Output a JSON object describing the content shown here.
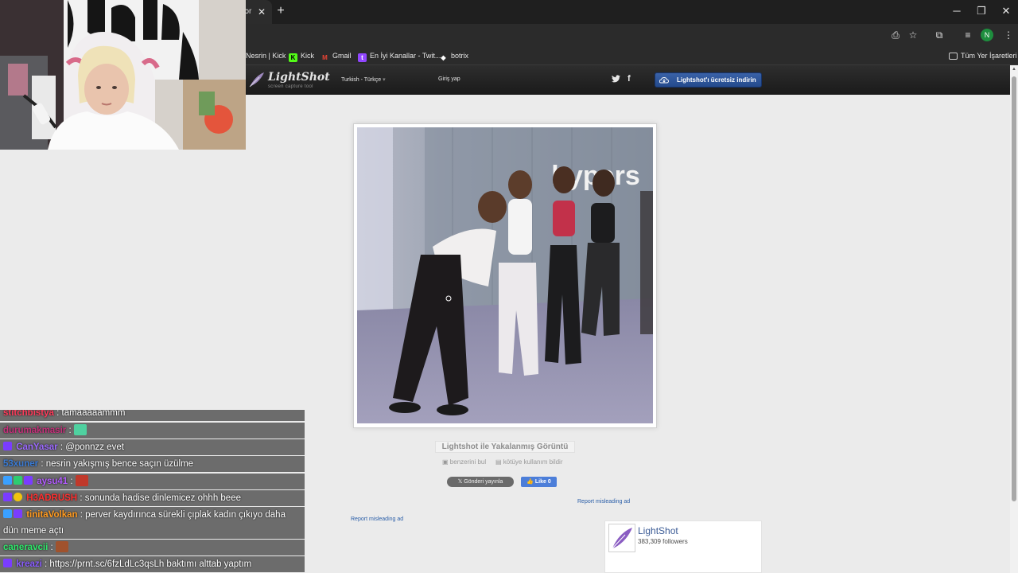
{
  "browser": {
    "tab": {
      "title": "ɔr"
    },
    "window_controls": {
      "minimize": "─",
      "restore": "❐",
      "close": "✕"
    },
    "toolbar": {
      "profile_initial": "N"
    },
    "bookmarks": [
      {
        "label": "Nesrin | Kick",
        "icon": "",
        "icon_color": "#2b2b2b"
      },
      {
        "label": "Kick",
        "icon": "K",
        "icon_color": "#53fc18"
      },
      {
        "label": "Gmail",
        "icon": "M",
        "icon_color": "#ea4335"
      },
      {
        "label": "En İyi Kanallar - Twit...",
        "icon": "t",
        "icon_color": "#9146ff"
      },
      {
        "label": "botrix",
        "icon": "◆",
        "icon_color": "#2b2b2b"
      }
    ],
    "all_bookmarks": "Tüm Yer İşaretleri"
  },
  "lightshot": {
    "brand": "LightShot",
    "tagline": "screen capture tool",
    "language": "Turkish - Türkçe",
    "login": "Giriş yap",
    "twitter_icon": "twitter-icon",
    "facebook_icon": "f",
    "download_button": "Lightshot'ı ücretsiz indirin",
    "overlay_text": "hypers",
    "caption": "Lightshot ile Yakalanmış Görüntü",
    "find_similar": "benzerini bul",
    "report_abuse": "kötüye kullanım bildir",
    "tweet_button": "Gönderi yayınla",
    "like_button": "Like 0",
    "report_ad_right": "Report misleading ad",
    "report_ad_left": "Report misleading ad",
    "facebook_widget": {
      "name": "LightShot",
      "followers": "383,309 followers"
    }
  },
  "chat": {
    "messages": [
      {
        "user": "stitchbistya",
        "user_color": "#ff3b5b",
        "text": ": tamaaaaammm",
        "badges": [],
        "emote": false
      },
      {
        "user": "durumakmasir",
        "user_color": "#c5307a",
        "text": ":",
        "badges": [],
        "emote": true,
        "emote_color": "#4fd1a0"
      },
      {
        "user": "CanYasar",
        "user_color": "#9d6bff",
        "text": ": @ponnzz evet",
        "badges": [
          "#7a3cff"
        ],
        "emote": false
      },
      {
        "user": "53xuner",
        "user_color": "#3a7bd5",
        "text": ": nesrin yakışmış bence saçın üzülme",
        "badges": [],
        "emote": false
      },
      {
        "user": "aysu41",
        "user_color": "#b35cff",
        "text": ":",
        "badges": [
          "#3aa0ff",
          "#2ecc71",
          "#7a3cff"
        ],
        "emote": true,
        "emote_color": "#c0392b"
      },
      {
        "user": "H3ADRUSH",
        "user_color": "#ff3030",
        "text": ": sonunda hadise dinlemicez ohhh beee",
        "badges": [
          "#7a3cff",
          "#f1c40f"
        ],
        "emote": false
      },
      {
        "user": "tinitaVolkan",
        "user_color": "#ff9a1f",
        "text": ": perver kaydırınca sürekli çıplak kadın çıkıyo daha dün meme açtı",
        "badges": [
          "#3aa0ff",
          "#7a3cff"
        ],
        "emote": false
      },
      {
        "user": "caneravcii",
        "user_color": "#2ee86b",
        "text": ":",
        "badges": [],
        "emote": true,
        "emote_color": "#a0522d"
      },
      {
        "user": "kreazi",
        "user_color": "#8a5cff",
        "text": ": https://prnt.sc/6fzLdLc3qsLh baktımı alttab yaptım",
        "badges": [
          "#7a3cff"
        ],
        "emote": false
      }
    ]
  }
}
